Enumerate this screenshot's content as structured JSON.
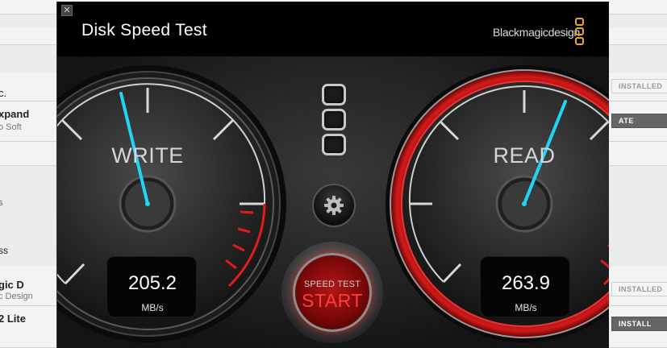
{
  "background": {
    "left_items": [
      {
        "text": "c.",
        "sub": ""
      },
      {
        "text": "xpand",
        "sub": "o Soft"
      },
      {
        "text": "gic D",
        "sub": "c Design"
      },
      {
        "text": "2 Lite",
        "sub": ""
      }
    ],
    "left_fragments": [
      "s",
      "ss"
    ],
    "buttons": [
      "INSTALLED",
      "ATE",
      "INSTALLED",
      "INSTALL"
    ]
  },
  "window": {
    "close_glyph": "✕",
    "title": "Disk Speed Test",
    "brand": "Blackmagicdesign",
    "brand_color": "#e8a53a"
  },
  "controls": {
    "settings_icon": "gear-icon",
    "start_small": "SPEED TEST",
    "start_big": "START"
  },
  "gauges": {
    "write": {
      "label": "WRITE",
      "value": "205.2",
      "unit": "MB/s",
      "needle_color": "#22d3f5"
    },
    "read": {
      "label": "READ",
      "value": "263.9",
      "unit": "MB/s",
      "needle_color": "#22d3f5",
      "ring_color": "#c0151a"
    }
  }
}
